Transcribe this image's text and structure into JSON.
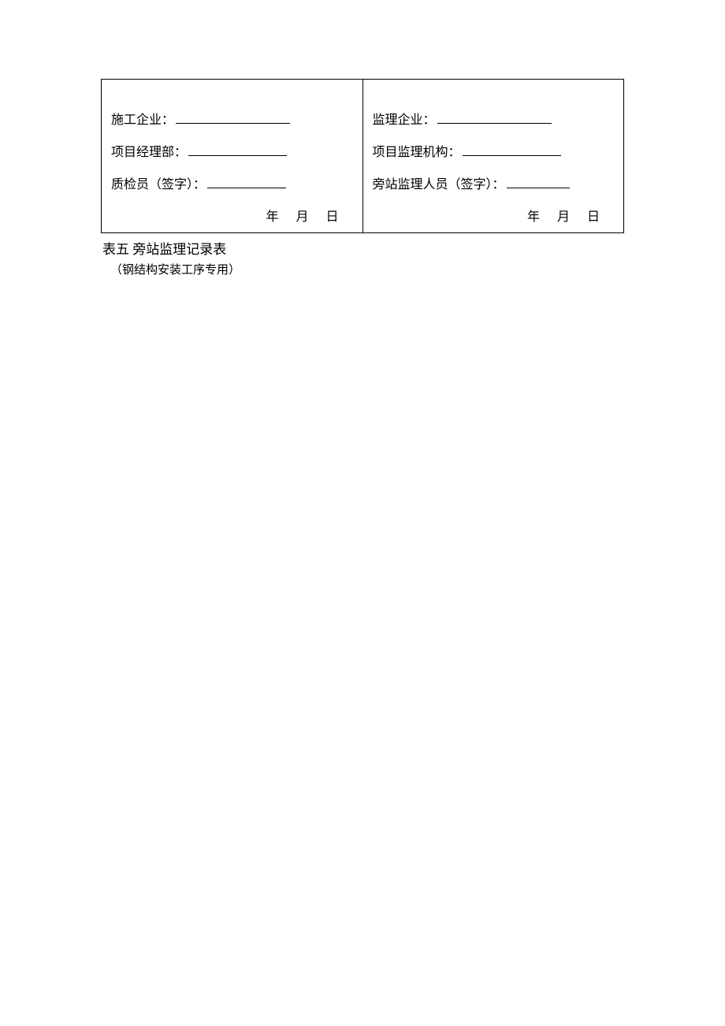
{
  "left": {
    "constructionCompany": "施工企业：",
    "projectDept": "项目经理部：",
    "inspector": "质检员（签字）："
  },
  "right": {
    "supervisionCompany": "监理企业：",
    "supervisionOrg": "项目监理机构：",
    "standbySupervisor": "旁站监理人员（签字）："
  },
  "date": {
    "year": "年",
    "month": "月",
    "day": "日"
  },
  "footer": {
    "title": "表五  旁站监理记录表",
    "subtitle": "（钢结构安装工序专用）"
  }
}
